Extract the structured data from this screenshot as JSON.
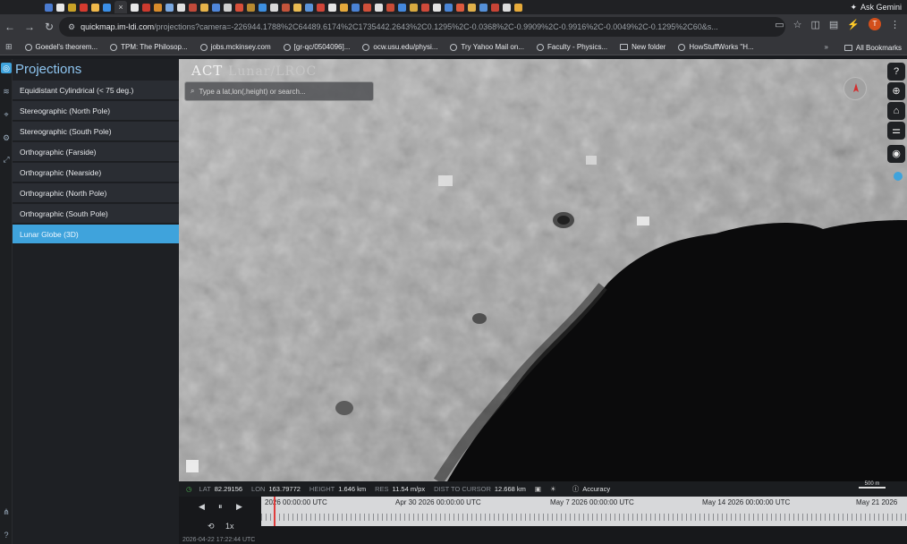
{
  "browser": {
    "ask_gemini_label": "Ask Gemini",
    "profile_initial": "T",
    "url_host": "quickmap.im-ldi.com",
    "url_rest": "/projections?camera=-226944.1788%2C64489.6174%2C1735442.2643%2C0.1295%2C-0.0368%2C-0.9909%2C-0.9916%2C-0.0049%2C-0.1295%2C60&s...",
    "tab_favicon_colors": [
      "#4a7bd0",
      "#e8e8e8",
      "#c9a227",
      "#d63b2f",
      "#f0b84a",
      "#3a8ee6",
      "#e8e8e8",
      "#cc3a2e",
      "#d98c2b",
      "#7aa8e0",
      "#e0e0e0",
      "#c24a3a",
      "#e6b34a",
      "#4f86d9",
      "#cfcfcf",
      "#d84f3a",
      "#b88a30",
      "#3d8fe0",
      "#d9d9d9",
      "#c4543b",
      "#e9bb52",
      "#5a93d8",
      "#d24538",
      "#e6e6e6",
      "#e5a93c",
      "#4a82d4",
      "#d0503a",
      "#e0e0e0",
      "#c94b36",
      "#4488dd",
      "#d8a940",
      "#cf4a3a",
      "#e2e2e2",
      "#4a85d5",
      "#dd5a3e",
      "#e0b04a",
      "#5590d8",
      "#c84436",
      "#dcdcdc",
      "#e6aa3a"
    ],
    "bookmarks": [
      {
        "label": "Goedel's theorem...",
        "icon": "globe-icon"
      },
      {
        "label": "TPM: The Philosop...",
        "icon": "globe-icon"
      },
      {
        "label": "jobs.mckinsey.com",
        "icon": "globe-icon"
      },
      {
        "label": "[gr-qc/0504096]...",
        "icon": "globe-icon"
      },
      {
        "label": "ocw.usu.edu/physi...",
        "icon": "globe-icon"
      },
      {
        "label": "Try Yahoo Mail on...",
        "icon": "globe-icon"
      },
      {
        "label": "Faculty - Physics...",
        "icon": "globe-icon"
      },
      {
        "label": "New folder",
        "icon": "folder-icon"
      },
      {
        "label": "HowStuffWorks \"H...",
        "icon": "globe-icon"
      }
    ],
    "all_bookmarks_label": "All Bookmarks"
  },
  "app": {
    "logo": "ACT",
    "logo_sub": "Lunar/LROC",
    "search_placeholder": "Type a lat,lon(,height) or search...",
    "panel_title": "Projections",
    "projections": [
      "Equidistant Cylindrical (< 75 deg.)",
      "Stereographic (North Pole)",
      "Stereographic (South Pole)",
      "Orthographic (Farside)",
      "Orthographic (Nearside)",
      "Orthographic (North Pole)",
      "Orthographic (South Pole)",
      "Lunar Globe (3D)"
    ],
    "active_projection_index": 7,
    "accent_color": "#3fa3dc"
  },
  "status": {
    "lat_label": "LAT",
    "lat_value": "82.29156",
    "lon_label": "LON",
    "lon_value": "163.79772",
    "height_label": "HEIGHT",
    "height_value": "1.646 km",
    "res_label": "RES",
    "res_value": "11.54 m/px",
    "dist_label": "DIST TO CURSOR",
    "dist_value": "12.668 km",
    "accuracy_label": "Accuracy",
    "scale_label": "500 m"
  },
  "timeline": {
    "dates": [
      "2026 00:00:00 UTC",
      "Apr 30 2026 00:00:00 UTC",
      "May 7 2026 00:00:00 UTC",
      "May 14 2026 00:00:00 UTC",
      "May 21 2026"
    ],
    "speed": "1x",
    "current_time": "2026-04-22 17:22:44 UTC"
  }
}
